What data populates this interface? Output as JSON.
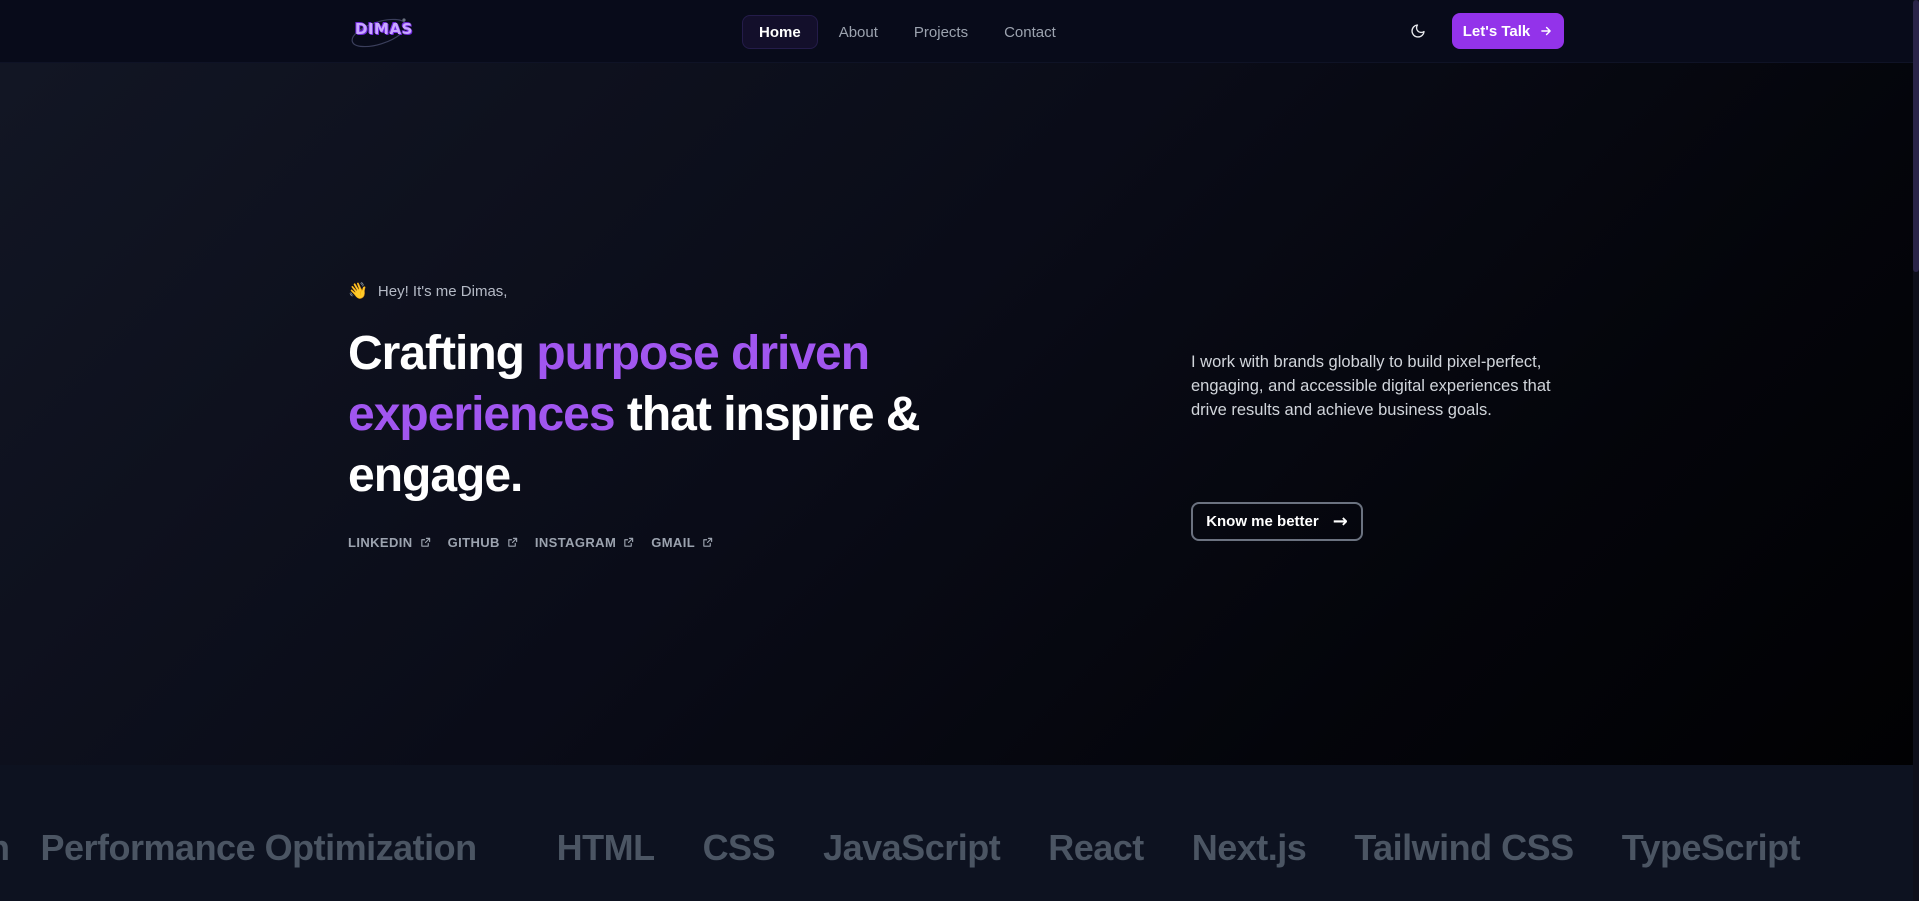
{
  "header": {
    "logo_text": "DIMAS",
    "nav": [
      {
        "label": "Home",
        "active": true
      },
      {
        "label": "About",
        "active": false
      },
      {
        "label": "Projects",
        "active": false
      },
      {
        "label": "Contact",
        "active": false
      }
    ],
    "theme_icon": "moon-icon",
    "cta_label": "Let's Talk"
  },
  "hero": {
    "greeting_emoji": "👋",
    "greeting": "Hey! It's me Dimas,",
    "headline": {
      "part1": "Crafting ",
      "accent": "purpose driven experiences",
      "part2": " that inspire & engage."
    },
    "socials": [
      {
        "label": "LINKEDIN",
        "icon": "external-link-icon"
      },
      {
        "label": "GITHUB",
        "icon": "external-link-icon"
      },
      {
        "label": "INSTAGRAM",
        "icon": "external-link-icon"
      },
      {
        "label": "GMAIL",
        "icon": "external-link-icon"
      }
    ],
    "blurb": "I work with brands globally to build pixel-perfect, engaging, and accessible digital experiences that drive results and achieve business goals.",
    "know_button": "Know me better",
    "know_arrow": "→"
  },
  "skills": {
    "partial": "n",
    "items": [
      "Performance Optimization",
      "HTML",
      "CSS",
      "JavaScript",
      "React",
      "Next.js",
      "Tailwind CSS",
      "TypeScript"
    ]
  },
  "colors": {
    "accent": "#9333ea",
    "headline_accent": "#a156f0",
    "background": "#05070f"
  }
}
